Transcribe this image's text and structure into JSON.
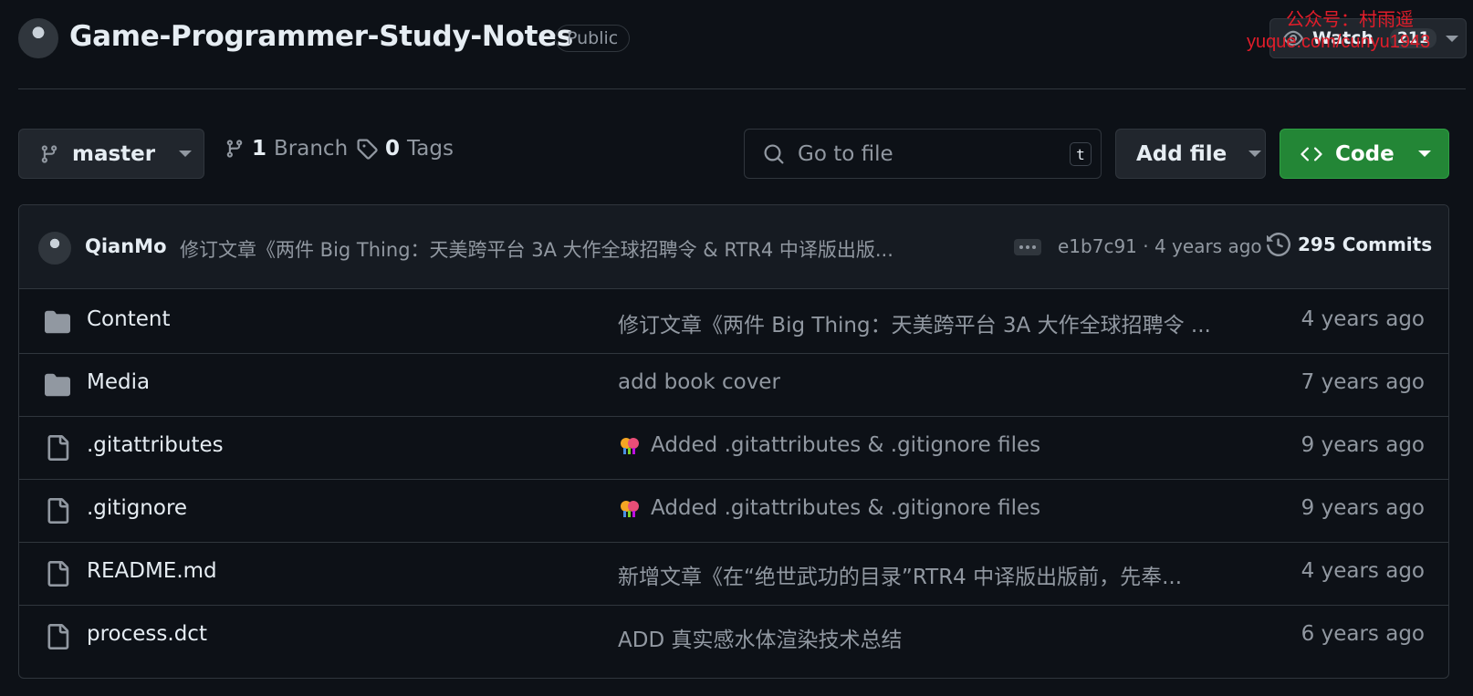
{
  "header": {
    "repo_name": "Game-Programmer-Study-Notes",
    "visibility": "Public",
    "watch_label": "Watch",
    "watch_count": "211"
  },
  "watermark": {
    "line1": "公众号：村雨遥",
    "line2": "yuque.com/cunyu1943"
  },
  "toolbar": {
    "branch": "master",
    "branch_count": "1",
    "branch_label": "Branch",
    "tag_count": "0",
    "tag_label": "Tags",
    "search_placeholder": "Go to file",
    "search_shortcut": "t",
    "add_file_label": "Add file",
    "code_label": "Code"
  },
  "latest_commit": {
    "author": "QianMo",
    "message": "修订文章《两件 Big Thing：天美跨平台 3A 大作全球招聘令 & RTR4 中译版出版...",
    "hash_age": "e1b7c91 · 4 years ago",
    "commits_label": "295 Commits"
  },
  "files": [
    {
      "name": "Content",
      "type": "folder",
      "message": "修订文章《两件 Big Thing：天美跨平台 3A 大作全球招聘令 ...",
      "age": "4 years ago",
      "emoji": false
    },
    {
      "name": "Media",
      "type": "folder",
      "message": "add book cover",
      "age": "7 years ago",
      "emoji": false
    },
    {
      "name": ".gitattributes",
      "type": "file",
      "message": "Added .gitattributes & .gitignore files",
      "age": "9 years ago",
      "emoji": true
    },
    {
      "name": ".gitignore",
      "type": "file",
      "message": "Added .gitattributes & .gitignore files",
      "age": "9 years ago",
      "emoji": true
    },
    {
      "name": "README.md",
      "type": "file",
      "message": "新增文章《在“绝世武功的目录”RTR4 中译版出版前，先奉...",
      "age": "4 years ago",
      "emoji": false
    },
    {
      "name": "process.dct",
      "type": "file",
      "message": "ADD 真实感水体渲染技术总结",
      "age": "6 years ago",
      "emoji": false
    }
  ],
  "colors": {
    "background": "#0d1117",
    "code_button": "#238636",
    "border": "#30363d",
    "muted_text": "#9198a1"
  }
}
